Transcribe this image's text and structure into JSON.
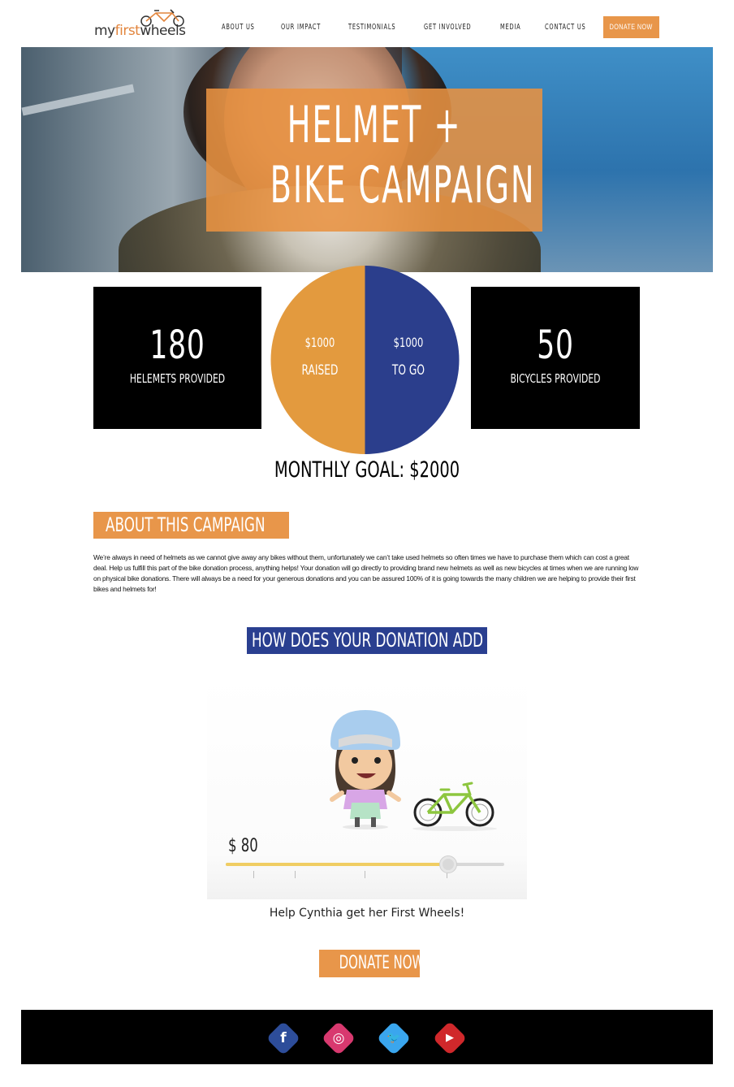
{
  "header": {
    "logo": {
      "my": "my",
      "first": "first",
      "wheels": "wheels"
    },
    "nav": [
      {
        "label": "About Us"
      },
      {
        "label": "Our Impact"
      },
      {
        "label": "Testimonials"
      },
      {
        "label": "Get Involved"
      },
      {
        "label": "Media"
      },
      {
        "label": "Contact Us"
      }
    ],
    "donate_label": "Donate Now"
  },
  "hero": {
    "title_line1": "HELMET +",
    "title_line2": "BIKE CAMPAIGN"
  },
  "stats": {
    "helmets": {
      "value": "180",
      "label": "Helemets Provided"
    },
    "bicycles": {
      "value": "50",
      "label": "Bicycles Provided"
    }
  },
  "chart_data": {
    "type": "pie",
    "title": "",
    "slices": [
      {
        "label": "Raised",
        "value": 1000,
        "display_value": "$1000",
        "color": "#e39a3e"
      },
      {
        "label": "To Go",
        "value": 1000,
        "display_value": "$1000",
        "color": "#2b3e8c"
      }
    ],
    "legend": "none"
  },
  "goal": "Monthly Goal: $2000",
  "about": {
    "heading": "About this campaign",
    "body": "We’re always in need of helmets as we cannot give away any bikes without them, unfortunately we can’t take used helmets so often times we have to purchase them which can cost a great deal. Help us fulfill this part of the bike donation process, anything helps! Your donation will go directly to providing brand  new helmets as well as new bicycles at times when we are running low on physical bike donations. There will always be a need for your generous donations and you can be assured  100% of it is going towards the many children we are helping to provide their first bikes and helmets for!"
  },
  "calculator": {
    "heading": "How does your donation add up?",
    "amount": "$ 80",
    "slider_fraction": 0.8,
    "caption": "Help Cynthia get her First Wheels!"
  },
  "donate_button": "Donate Now",
  "colors": {
    "orange": "#e8964a",
    "navy": "#2a3f90",
    "black": "#000000"
  },
  "footer": {
    "social": [
      {
        "name": "facebook-icon",
        "glyph": "f",
        "color": "#2d4d9a"
      },
      {
        "name": "instagram-icon",
        "glyph": "◎",
        "color": "#d8396f"
      },
      {
        "name": "twitter-icon",
        "glyph": "🐦",
        "color": "#3aa6ee"
      },
      {
        "name": "youtube-icon",
        "glyph": "▶",
        "color": "#d0282b"
      }
    ]
  }
}
